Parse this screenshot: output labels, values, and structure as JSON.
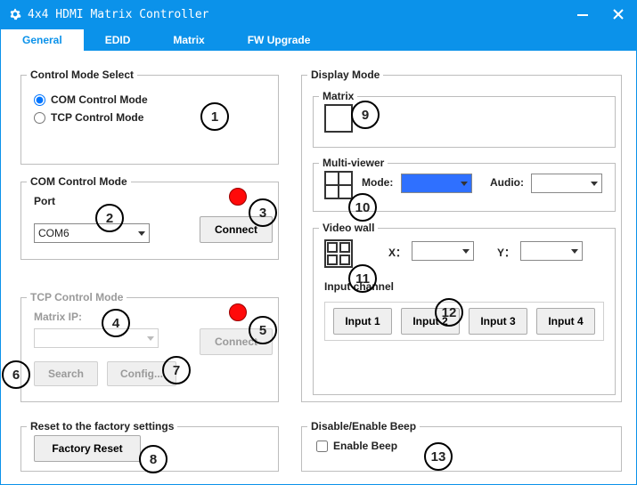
{
  "window": {
    "title": "4x4 HDMI Matrix Controller"
  },
  "tabs": {
    "general": "General",
    "edid": "EDID",
    "matrix": "Matrix",
    "fw": "FW Upgrade"
  },
  "control_mode_select": {
    "legend": "Control Mode Select",
    "com": "COM Control Mode",
    "tcp": "TCP Control Mode",
    "selected": "com"
  },
  "com_mode": {
    "legend": "COM Control Mode",
    "port_label": "Port",
    "port_value": "COM6",
    "connect": "Connect"
  },
  "tcp_mode": {
    "legend": "TCP Control Mode",
    "matrix_ip_label": "Matrix IP:",
    "matrix_ip_value": "",
    "connect": "Connect",
    "search": "Search",
    "config": "Config..."
  },
  "reset": {
    "legend": "Reset to the factory settings",
    "button": "Factory Reset"
  },
  "display_mode": {
    "legend": "Display Mode",
    "matrix_legend": "Matrix",
    "mv_legend": "Multi-viewer",
    "mv_mode_label": "Mode:",
    "mv_mode_value": "",
    "mv_audio_label": "Audio:",
    "mv_audio_value": "",
    "vw_legend": "Video wall",
    "vw_x_label": "X：",
    "vw_y_label": "Y：",
    "vw_x_value": "",
    "vw_y_value": "",
    "input_channel_label": "Input channel",
    "inputs": {
      "i1": "Input 1",
      "i2": "Input 2",
      "i3": "Input 3",
      "i4": "Input 4"
    }
  },
  "beep": {
    "legend": "Disable/Enable Beep",
    "label": "Enable Beep"
  },
  "callouts": {
    "c1": "1",
    "c2": "2",
    "c3": "3",
    "c4": "4",
    "c5": "5",
    "c6": "6",
    "c7": "7",
    "c8": "8",
    "c9": "9",
    "c10": "10",
    "c11": "11",
    "c12": "12",
    "c13": "13"
  }
}
